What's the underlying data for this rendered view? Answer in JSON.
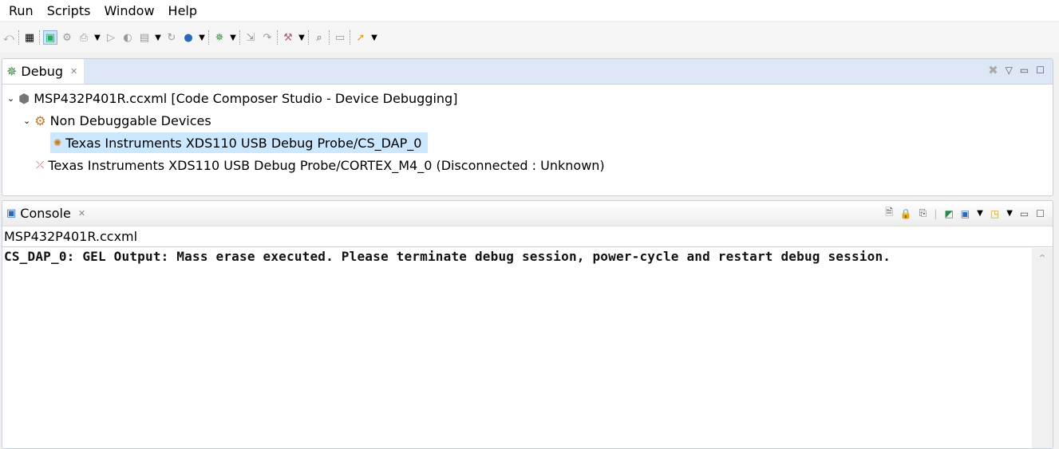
{
  "menu": [
    "Run",
    "Scripts",
    "Window",
    "Help"
  ],
  "toolbar_icons": [
    "step-return-icon",
    "grid-icon",
    "debug-target-icon",
    "connect-icon",
    "load-program-icon",
    "dropdown",
    "resume-icon",
    "suspend-icon",
    "terminate-icon",
    "dropdown",
    "restart-icon",
    "bomb-icon",
    "dropdown",
    "bug-icon",
    "dropdown",
    "step-into-icon",
    "step-over-icon",
    "hammer-icon",
    "dropdown",
    "search-icon",
    "terminal-icon",
    "rocket-icon",
    "dropdown"
  ],
  "debug": {
    "tab": "Debug",
    "tree": [
      {
        "label": "MSP432P401R.ccxml [Code Composer Studio - Device Debugging]"
      },
      {
        "label": "Non Debuggable Devices"
      },
      {
        "label": "Texas Instruments XDS110 USB Debug Probe/CS_DAP_0"
      },
      {
        "label": "Texas Instruments XDS110 USB Debug Probe/CORTEX_M4_0 (Disconnected : Unknown)"
      }
    ]
  },
  "console": {
    "tab": "Console",
    "subtitle": "MSP432P401R.ccxml",
    "output": "CS_DAP_0: GEL Output: Mass erase executed. Please terminate debug session, power-cycle and restart debug session."
  }
}
